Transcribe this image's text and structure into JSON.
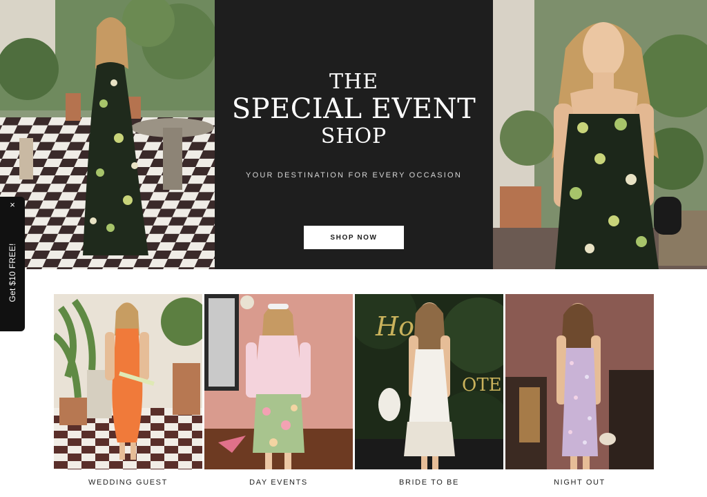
{
  "hero": {
    "title_line1": "THE",
    "title_line2": "SPECIAL EVENT",
    "title_line3": "SHOP",
    "subtitle": "YOUR DESTINATION FOR EVERY OCCASION",
    "cta_label": "SHOP NOW"
  },
  "promo": {
    "text": "Get $10 FREE!",
    "close_glyph": "×"
  },
  "categories": [
    {
      "label": "WEDDING GUEST"
    },
    {
      "label": "DAY EVENTS"
    },
    {
      "label": "BRIDE TO BE"
    },
    {
      "label": "NIGHT OUT"
    }
  ],
  "colors": {
    "hero_panel": "#1e1e1e",
    "button_bg": "#ffffff",
    "promo_tab": "#111111",
    "text_dark": "#1a1a1a"
  }
}
